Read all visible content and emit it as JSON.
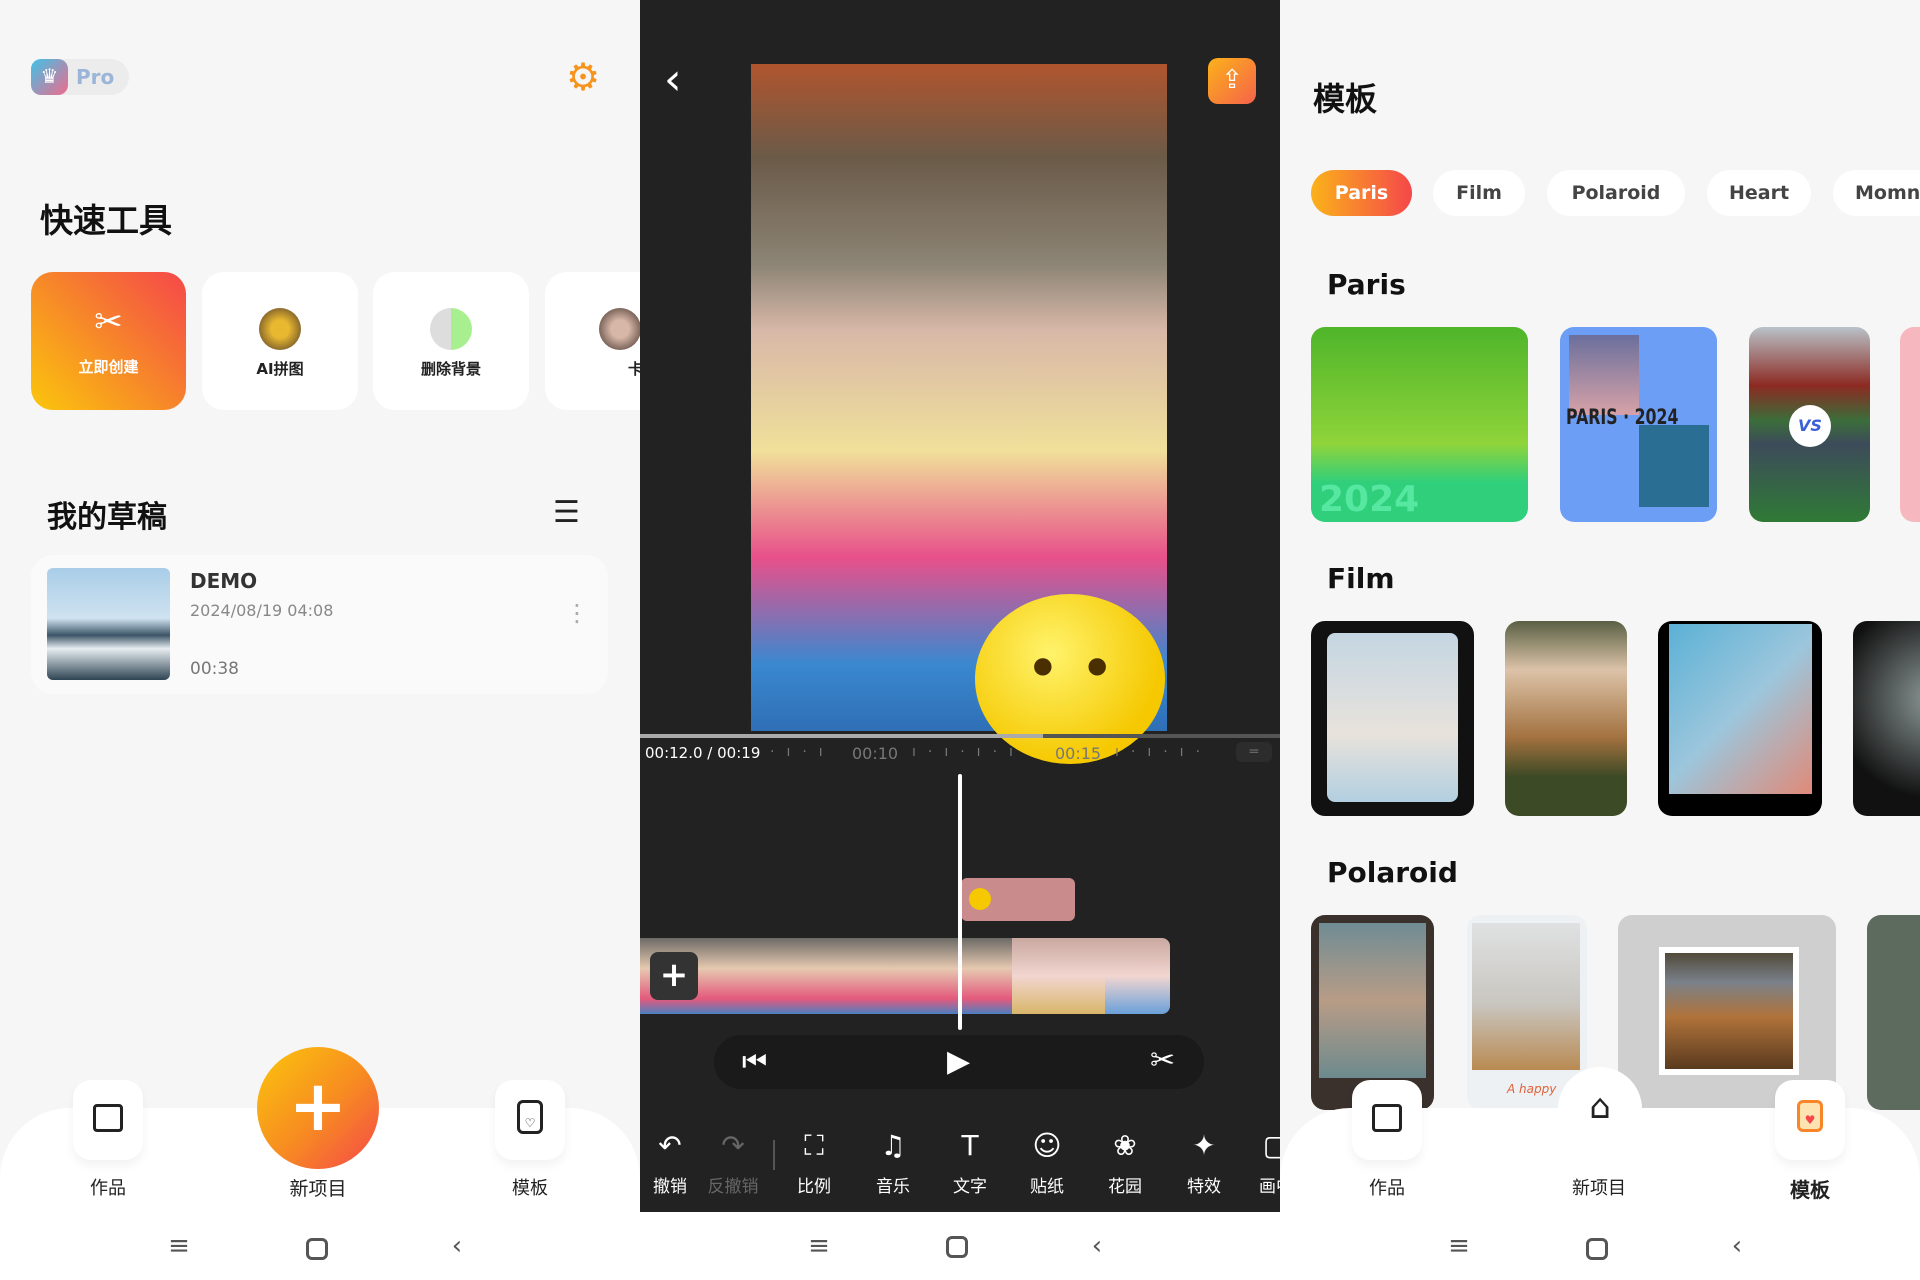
{
  "home": {
    "pro_label": "Pro",
    "quick_tools_title": "快速工具",
    "tools": [
      {
        "label": "立即创建",
        "icon": "scissors-icon"
      },
      {
        "label": "AI拼图"
      },
      {
        "label": "删除背景"
      },
      {
        "label": "卡通"
      }
    ],
    "drafts_title": "我的草稿",
    "draft": {
      "name": "DEMO",
      "date": "2024/08/19 04:08",
      "duration": "00:38"
    },
    "tabs": [
      {
        "label": "作品",
        "icon": "gallery-icon"
      },
      {
        "label": "新项目",
        "icon": "plus-icon"
      },
      {
        "label": "模板",
        "icon": "template-icon"
      }
    ]
  },
  "editor": {
    "time_current": "00:12.0 / 00:19",
    "tick_10": "00:10",
    "tick_15": "00:15",
    "progress": 0.63,
    "tools": [
      {
        "label": "撤销",
        "icon": "undo-icon"
      },
      {
        "label": "反撤销",
        "icon": "redo-icon"
      },
      {
        "label": "比例",
        "icon": "ratio-icon"
      },
      {
        "label": "音乐",
        "icon": "music-icon"
      },
      {
        "label": "文字",
        "icon": "text-icon"
      },
      {
        "label": "贴纸",
        "icon": "sticker-icon"
      },
      {
        "label": "花园",
        "icon": "garden-icon"
      },
      {
        "label": "特效",
        "icon": "effects-icon"
      },
      {
        "label": "画中",
        "icon": "pip-icon"
      }
    ]
  },
  "templates": {
    "title": "模板",
    "chips": [
      "Paris",
      "Film",
      "Polaroid",
      "Heart",
      "Momn"
    ],
    "sections": [
      "Paris",
      "Film",
      "Polaroid"
    ],
    "paris_thumb_text": "PARIS · 2024",
    "paris_thumb_year": "2024",
    "polaroid_caption": "A happy",
    "tabs": [
      {
        "label": "作品"
      },
      {
        "label": "新项目"
      },
      {
        "label": "模板"
      }
    ]
  },
  "colors": {
    "accent_start": "#fbbf0c",
    "accent_end": "#f5444a",
    "dark_bg": "#222222",
    "sticker_clip": "#c98b8b"
  }
}
